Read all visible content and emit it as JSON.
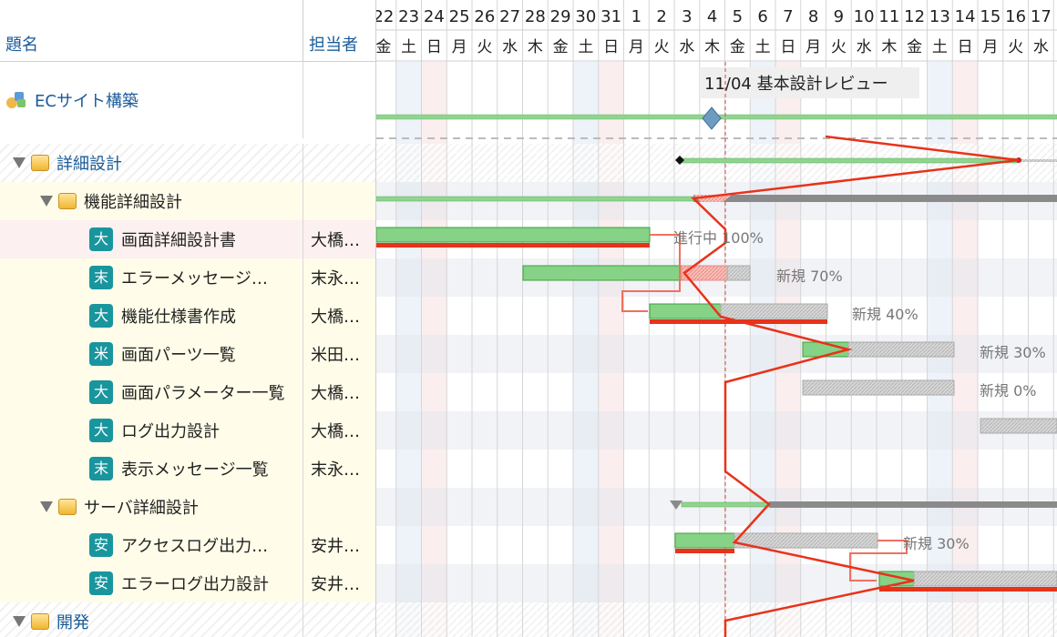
{
  "header": {
    "title_col": "題名",
    "assignee_col": "担当者"
  },
  "project": {
    "name": "ECサイト構築",
    "milestone_label": "11/04 基本設計レビュー"
  },
  "tasks": [
    {
      "title": "詳細設計",
      "kind": "group",
      "assignee": ""
    },
    {
      "title": "機能詳細設計",
      "kind": "subgroup",
      "assignee": ""
    },
    {
      "title": "画面詳細設計書",
      "kind": "task",
      "badge": "大",
      "assignee": "大橋…",
      "status": "進行中 100%"
    },
    {
      "title": "エラーメッセージ…",
      "kind": "task",
      "badge": "末",
      "assignee": "末永…",
      "status": "新規 70%"
    },
    {
      "title": "機能仕様書作成",
      "kind": "task",
      "badge": "大",
      "assignee": "大橋…",
      "status": "新規 40%"
    },
    {
      "title": "画面パーツ一覧",
      "kind": "task",
      "badge": "米",
      "assignee": "米田…",
      "status": "新規 30%"
    },
    {
      "title": "画面パラメーター一覧",
      "kind": "task",
      "badge": "大",
      "assignee": "大橋…",
      "status": "新規 0%"
    },
    {
      "title": "ログ出力設計",
      "kind": "task",
      "badge": "大",
      "assignee": "大橋…",
      "status": ""
    },
    {
      "title": "表示メッセージ一覧",
      "kind": "task",
      "badge": "末",
      "assignee": "末永…",
      "status": ""
    },
    {
      "title": "サーバ詳細設計",
      "kind": "subgroup",
      "assignee": ""
    },
    {
      "title": "アクセスログ出力…",
      "kind": "task",
      "badge": "安",
      "assignee": "安井…",
      "status": "新規 30%"
    },
    {
      "title": "エラーログ出力設計",
      "kind": "task",
      "badge": "安",
      "assignee": "安井…",
      "status": ""
    },
    {
      "title": "開発",
      "kind": "group",
      "assignee": ""
    }
  ],
  "timeline": {
    "dates": [
      "22",
      "23",
      "24",
      "25",
      "26",
      "27",
      "28",
      "29",
      "30",
      "31",
      "1",
      "2",
      "3",
      "4",
      "5",
      "6",
      "7",
      "8",
      "9",
      "10",
      "11",
      "12",
      "13",
      "14",
      "15",
      "16",
      "17"
    ],
    "weekdays": [
      "金",
      "土",
      "日",
      "月",
      "火",
      "水",
      "木",
      "金",
      "土",
      "日",
      "月",
      "火",
      "水",
      "木",
      "金",
      "土",
      "日",
      "月",
      "火",
      "水",
      "木",
      "金",
      "土",
      "日",
      "月",
      "火",
      "水"
    ]
  },
  "colors": {
    "accent": "#1a5b9a",
    "progress_green": "#7fcf7f",
    "baseline_red": "#e8321a",
    "badge_teal": "#19959e"
  }
}
